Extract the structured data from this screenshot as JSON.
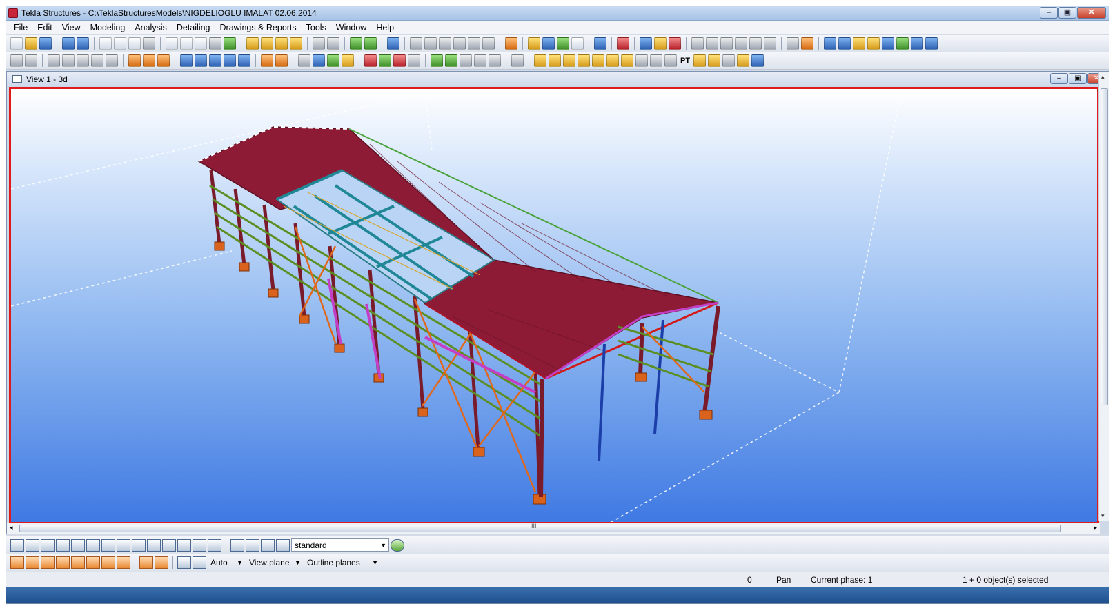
{
  "window": {
    "title": "Tekla Structures - C:\\TeklaStructuresModels\\NIGDELIOGLU IMALAT 02.06.2014",
    "minimize": "–",
    "maximize": "▣",
    "close": "✕"
  },
  "menu": [
    "File",
    "Edit",
    "View",
    "Modeling",
    "Analysis",
    "Detailing",
    "Drawings & Reports",
    "Tools",
    "Window",
    "Help"
  ],
  "toolbar2_text_icon": "PT",
  "view": {
    "title": "View 1 - 3d"
  },
  "scroll": {
    "grip": "III",
    "left": "◂",
    "right": "▸",
    "up": "▴",
    "down": "▾"
  },
  "selection_filter": {
    "value": "standard"
  },
  "snap": {
    "depth": "Auto",
    "plane": "View plane",
    "outline": "Outline planes"
  },
  "status": {
    "value": "0",
    "mode": "Pan",
    "phase": "Current phase: 1",
    "selected": "1 + 0 object(s) selected"
  },
  "colors": {
    "roof": "#8e1b36",
    "column": "#7a1b2c",
    "base_plate": "#d9631c",
    "girt": "#5c8f23",
    "bracing": "#e0681c",
    "purlin": "#1f8796",
    "brace_blue": "#1c3ea8",
    "brace_magenta": "#c23fc6"
  }
}
